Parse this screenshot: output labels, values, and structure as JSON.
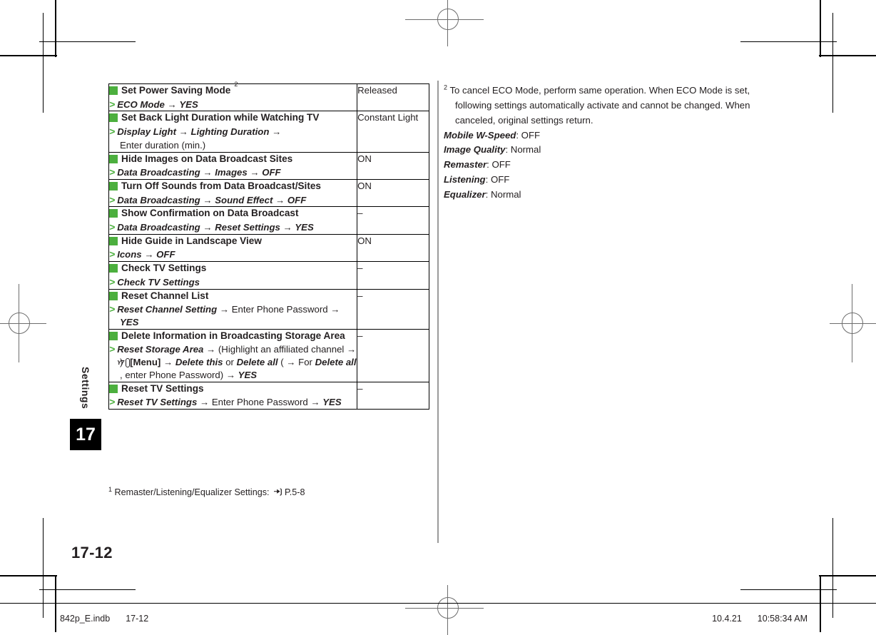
{
  "chapter_tab": {
    "label": "Settings",
    "number": "17"
  },
  "page_number": "17-12",
  "table": {
    "rows": [
      {
        "title": "Set Power Saving Mode",
        "title_sup": "2",
        "steps": [
          {
            "marker": ">",
            "segments": [
              {
                "text": "ECO Mode",
                "style": "menu"
              },
              {
                "text": "→",
                "style": "arrow"
              },
              {
                "text": "YES",
                "style": "menu"
              }
            ]
          }
        ],
        "value": "Released"
      },
      {
        "title": "Set Back Light Duration while Watching TV",
        "title_sup": "",
        "steps": [
          {
            "marker": ">",
            "segments": [
              {
                "text": "Display Light",
                "style": "menu"
              },
              {
                "text": "→",
                "style": "arrow"
              },
              {
                "text": "Lighting Duration",
                "style": "menu"
              },
              {
                "text": "→",
                "style": "arrow"
              }
            ]
          },
          {
            "marker": "",
            "segments": [
              {
                "text": "Enter duration (min.)",
                "style": "plain"
              }
            ]
          }
        ],
        "value": "Constant Light"
      },
      {
        "title": "Hide Images on Data Broadcast Sites",
        "title_sup": "",
        "steps": [
          {
            "marker": ">",
            "segments": [
              {
                "text": "Data Broadcasting",
                "style": "menu"
              },
              {
                "text": "→",
                "style": "arrow"
              },
              {
                "text": "Images",
                "style": "menu"
              },
              {
                "text": "→",
                "style": "arrow"
              },
              {
                "text": "OFF",
                "style": "menu"
              }
            ]
          }
        ],
        "value": "ON"
      },
      {
        "title": "Turn Off Sounds from Data Broadcast/Sites",
        "title_sup": "",
        "steps": [
          {
            "marker": ">",
            "segments": [
              {
                "text": "Data Broadcasting",
                "style": "menu"
              },
              {
                "text": "→",
                "style": "arrow"
              },
              {
                "text": "Sound Effect",
                "style": "menu"
              },
              {
                "text": "→",
                "style": "arrow"
              },
              {
                "text": "OFF",
                "style": "menu"
              }
            ]
          }
        ],
        "value": "ON"
      },
      {
        "title": "Show Confirmation on Data Broadcast",
        "title_sup": "",
        "steps": [
          {
            "marker": ">",
            "segments": [
              {
                "text": "Data Broadcasting",
                "style": "menu"
              },
              {
                "text": "→",
                "style": "arrow"
              },
              {
                "text": "Reset Settings",
                "style": "menu"
              },
              {
                "text": "→",
                "style": "arrow"
              },
              {
                "text": "YES",
                "style": "menu"
              }
            ]
          }
        ],
        "value": "–"
      },
      {
        "title": "Hide Guide in Landscape View",
        "title_sup": "",
        "steps": [
          {
            "marker": ">",
            "segments": [
              {
                "text": "Icons",
                "style": "menu"
              },
              {
                "text": "→",
                "style": "arrow"
              },
              {
                "text": "OFF",
                "style": "menu"
              }
            ]
          }
        ],
        "value": "ON"
      },
      {
        "title": "Check TV Settings",
        "title_sup": "",
        "steps": [
          {
            "marker": ">",
            "segments": [
              {
                "text": "Check TV Settings",
                "style": "menu"
              }
            ]
          }
        ],
        "value": "–"
      },
      {
        "title": "Reset Channel List",
        "title_sup": "",
        "steps": [
          {
            "marker": ">",
            "segments": [
              {
                "text": "Reset Channel Setting",
                "style": "menu"
              },
              {
                "text": "→",
                "style": "arrow"
              },
              {
                "text": "Enter Phone Password",
                "style": "plain"
              },
              {
                "text": "→",
                "style": "arrow"
              },
              {
                "text": "YES",
                "style": "menu"
              }
            ]
          }
        ],
        "value": "–"
      },
      {
        "title": "Delete Information in Broadcasting Storage Area",
        "title_sup": "",
        "steps": [
          {
            "marker": ">",
            "segments": [
              {
                "text": "Reset Storage Area",
                "style": "menu"
              },
              {
                "text": "→",
                "style": "arrow"
              },
              {
                "text": "(Highlight an affiliated channel",
                "style": "plain"
              },
              {
                "text": "→",
                "style": "arrow"
              },
              {
                "text": ")",
                "style": "plain"
              },
              {
                "text": "menu-key-icon",
                "style": "keyicon"
              },
              {
                "text": "[Menu]",
                "style": "bold"
              },
              {
                "text": "→",
                "style": "arrow"
              },
              {
                "text": "Delete this",
                "style": "menu"
              },
              {
                "text": "or",
                "style": "plain"
              },
              {
                "text": "Delete all",
                "style": "menu"
              },
              {
                "text": "(",
                "style": "plain"
              },
              {
                "text": "→",
                "style": "arrow"
              },
              {
                "text": "For",
                "style": "plain"
              },
              {
                "text": "Delete all",
                "style": "menu"
              },
              {
                "text": ", enter Phone Password)",
                "style": "plain"
              },
              {
                "text": "→",
                "style": "arrow"
              },
              {
                "text": "YES",
                "style": "menu"
              }
            ]
          }
        ],
        "value": "–"
      },
      {
        "title": "Reset TV Settings",
        "title_sup": "",
        "steps": [
          {
            "marker": ">",
            "segments": [
              {
                "text": "Reset TV Settings",
                "style": "menu"
              },
              {
                "text": "→",
                "style": "arrow"
              },
              {
                "text": "Enter Phone Password",
                "style": "plain"
              },
              {
                "text": "→",
                "style": "arrow"
              },
              {
                "text": "YES",
                "style": "menu"
              }
            ]
          }
        ],
        "value": "–"
      }
    ]
  },
  "table_footnote": {
    "marker": "1",
    "text": "Remaster/Listening/Equalizer Settings:",
    "icon": "pointing-hand-icon",
    "reference": "P.5-8"
  },
  "right_column": {
    "marker": "2",
    "paragraph": "To cancel ECO Mode, perform same operation. When ECO Mode is set, following settings automatically activate and cannot be changed. When canceled, original settings return.",
    "settings": [
      {
        "name": "Mobile W-Speed",
        "value": ": OFF"
      },
      {
        "name": "Image Quality",
        "value": ": Normal"
      },
      {
        "name": "Remaster",
        "value": ": OFF"
      },
      {
        "name": "Listening",
        "value": ": OFF"
      },
      {
        "name": "Equalizer",
        "value": ": Normal"
      }
    ]
  },
  "footer": {
    "filename": "842p_E.indb",
    "page": "17-12",
    "date": "10.4.21",
    "time": "10:58:34 AM"
  },
  "colors": {
    "accent_green": "#4CAF3E",
    "rule_gray": "#9a9a9a",
    "text": "#231f20"
  }
}
